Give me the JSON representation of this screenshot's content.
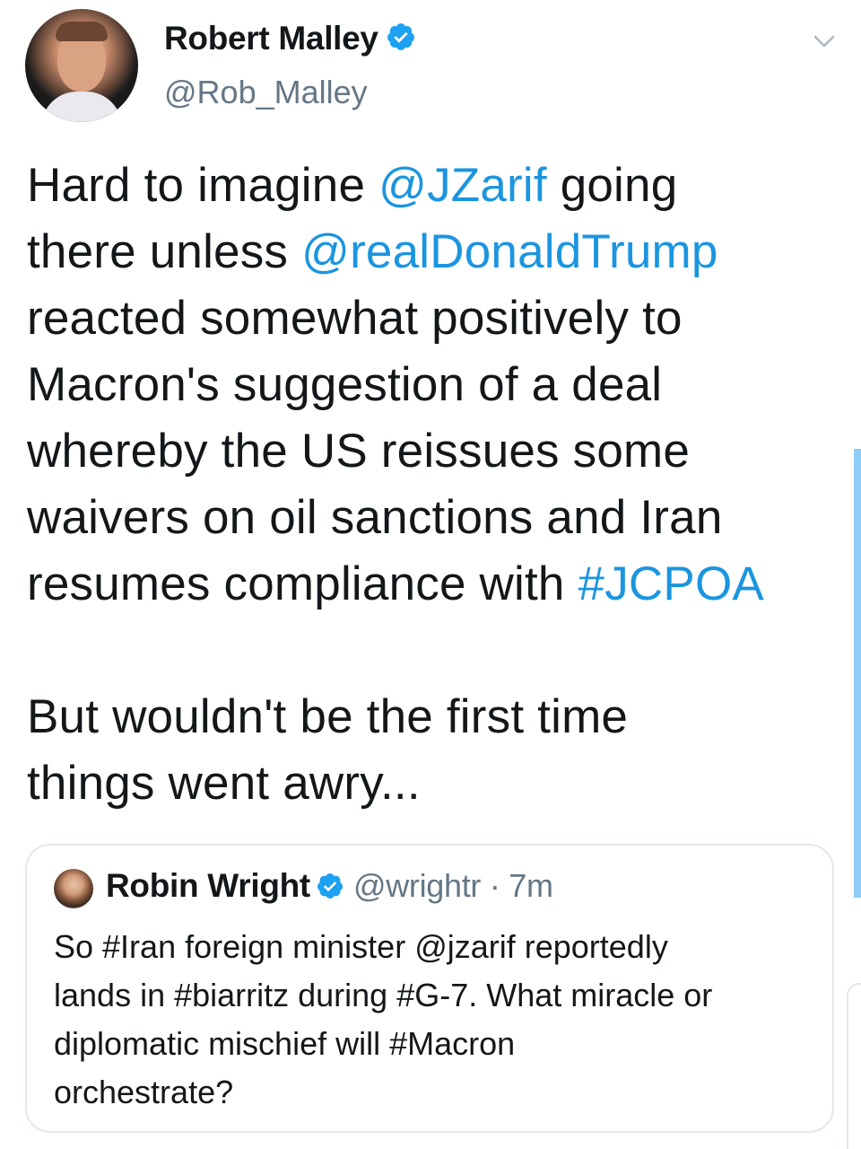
{
  "author": {
    "display_name": "Robert Malley",
    "handle": "@Rob_Malley",
    "verified": true,
    "avatar_icon": "profile-photo"
  },
  "menu": {
    "icon": "chevron-down-icon"
  },
  "tweet": {
    "lines": [
      [
        {
          "text": "Hard to imagine "
        },
        {
          "text": "@JZarif",
          "link": true
        },
        {
          "text": " going"
        }
      ],
      [
        {
          "text": "there unless "
        },
        {
          "text": "@realDonaldTrump",
          "link": true
        }
      ],
      [
        {
          "text": "reacted somewhat positively to"
        }
      ],
      [
        {
          "text": "Macron's suggestion of a deal"
        }
      ],
      [
        {
          "text": "whereby the US reissues some"
        }
      ],
      [
        {
          "text": "waivers on oil sanctions and Iran"
        }
      ],
      [
        {
          "text": "resumes compliance with "
        },
        {
          "text": "#JCPOA",
          "link": true
        }
      ]
    ],
    "lines2": [
      [
        {
          "text": "But wouldn't be the first time"
        }
      ],
      [
        {
          "text": "things went awry..."
        }
      ]
    ]
  },
  "quoted_tweet": {
    "display_name": "Robin Wright",
    "verified": true,
    "handle": "@wrightr",
    "separator": "·",
    "time": "7m",
    "lines": [
      "So #Iran foreign minister @jzarif reportedly",
      "lands in #biarritz during #G-7. What miracle or",
      "diplomatic mischief will  #Macron",
      "orchestrate?"
    ]
  },
  "colors": {
    "link": "#1b95e0",
    "verified": "#1da1f2",
    "muted": "#657786",
    "border": "#e1e8ed",
    "text": "#14171a"
  }
}
